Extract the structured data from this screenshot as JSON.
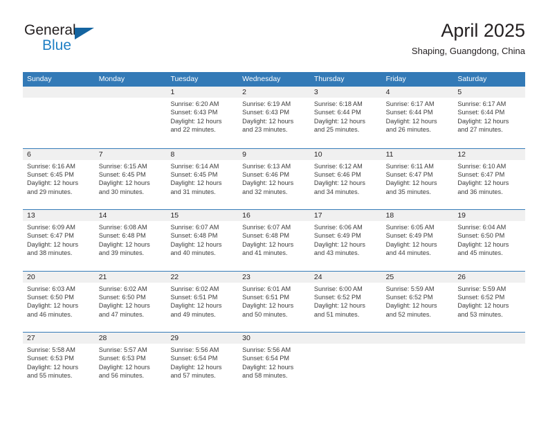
{
  "brand": {
    "name_part1": "General",
    "name_part2": "Blue",
    "triangle_color": "#1464a0",
    "blue_color": "#1f7fc4"
  },
  "header": {
    "month_title": "April 2025",
    "location": "Shaping, Guangdong, China"
  },
  "theme": {
    "header_blue": "#337ab7",
    "day_band_gray": "#f0f0f0",
    "text_dark": "#231f20"
  },
  "weekdays": [
    "Sunday",
    "Monday",
    "Tuesday",
    "Wednesday",
    "Thursday",
    "Friday",
    "Saturday"
  ],
  "weeks": [
    [
      {
        "day": "",
        "sunrise": "",
        "sunset": "",
        "daylight1": "",
        "daylight2": ""
      },
      {
        "day": "",
        "sunrise": "",
        "sunset": "",
        "daylight1": "",
        "daylight2": ""
      },
      {
        "day": "1",
        "sunrise": "Sunrise: 6:20 AM",
        "sunset": "Sunset: 6:43 PM",
        "daylight1": "Daylight: 12 hours",
        "daylight2": "and 22 minutes."
      },
      {
        "day": "2",
        "sunrise": "Sunrise: 6:19 AM",
        "sunset": "Sunset: 6:43 PM",
        "daylight1": "Daylight: 12 hours",
        "daylight2": "and 23 minutes."
      },
      {
        "day": "3",
        "sunrise": "Sunrise: 6:18 AM",
        "sunset": "Sunset: 6:44 PM",
        "daylight1": "Daylight: 12 hours",
        "daylight2": "and 25 minutes."
      },
      {
        "day": "4",
        "sunrise": "Sunrise: 6:17 AM",
        "sunset": "Sunset: 6:44 PM",
        "daylight1": "Daylight: 12 hours",
        "daylight2": "and 26 minutes."
      },
      {
        "day": "5",
        "sunrise": "Sunrise: 6:17 AM",
        "sunset": "Sunset: 6:44 PM",
        "daylight1": "Daylight: 12 hours",
        "daylight2": "and 27 minutes."
      }
    ],
    [
      {
        "day": "6",
        "sunrise": "Sunrise: 6:16 AM",
        "sunset": "Sunset: 6:45 PM",
        "daylight1": "Daylight: 12 hours",
        "daylight2": "and 29 minutes."
      },
      {
        "day": "7",
        "sunrise": "Sunrise: 6:15 AM",
        "sunset": "Sunset: 6:45 PM",
        "daylight1": "Daylight: 12 hours",
        "daylight2": "and 30 minutes."
      },
      {
        "day": "8",
        "sunrise": "Sunrise: 6:14 AM",
        "sunset": "Sunset: 6:45 PM",
        "daylight1": "Daylight: 12 hours",
        "daylight2": "and 31 minutes."
      },
      {
        "day": "9",
        "sunrise": "Sunrise: 6:13 AM",
        "sunset": "Sunset: 6:46 PM",
        "daylight1": "Daylight: 12 hours",
        "daylight2": "and 32 minutes."
      },
      {
        "day": "10",
        "sunrise": "Sunrise: 6:12 AM",
        "sunset": "Sunset: 6:46 PM",
        "daylight1": "Daylight: 12 hours",
        "daylight2": "and 34 minutes."
      },
      {
        "day": "11",
        "sunrise": "Sunrise: 6:11 AM",
        "sunset": "Sunset: 6:47 PM",
        "daylight1": "Daylight: 12 hours",
        "daylight2": "and 35 minutes."
      },
      {
        "day": "12",
        "sunrise": "Sunrise: 6:10 AM",
        "sunset": "Sunset: 6:47 PM",
        "daylight1": "Daylight: 12 hours",
        "daylight2": "and 36 minutes."
      }
    ],
    [
      {
        "day": "13",
        "sunrise": "Sunrise: 6:09 AM",
        "sunset": "Sunset: 6:47 PM",
        "daylight1": "Daylight: 12 hours",
        "daylight2": "and 38 minutes."
      },
      {
        "day": "14",
        "sunrise": "Sunrise: 6:08 AM",
        "sunset": "Sunset: 6:48 PM",
        "daylight1": "Daylight: 12 hours",
        "daylight2": "and 39 minutes."
      },
      {
        "day": "15",
        "sunrise": "Sunrise: 6:07 AM",
        "sunset": "Sunset: 6:48 PM",
        "daylight1": "Daylight: 12 hours",
        "daylight2": "and 40 minutes."
      },
      {
        "day": "16",
        "sunrise": "Sunrise: 6:07 AM",
        "sunset": "Sunset: 6:48 PM",
        "daylight1": "Daylight: 12 hours",
        "daylight2": "and 41 minutes."
      },
      {
        "day": "17",
        "sunrise": "Sunrise: 6:06 AM",
        "sunset": "Sunset: 6:49 PM",
        "daylight1": "Daylight: 12 hours",
        "daylight2": "and 43 minutes."
      },
      {
        "day": "18",
        "sunrise": "Sunrise: 6:05 AM",
        "sunset": "Sunset: 6:49 PM",
        "daylight1": "Daylight: 12 hours",
        "daylight2": "and 44 minutes."
      },
      {
        "day": "19",
        "sunrise": "Sunrise: 6:04 AM",
        "sunset": "Sunset: 6:50 PM",
        "daylight1": "Daylight: 12 hours",
        "daylight2": "and 45 minutes."
      }
    ],
    [
      {
        "day": "20",
        "sunrise": "Sunrise: 6:03 AM",
        "sunset": "Sunset: 6:50 PM",
        "daylight1": "Daylight: 12 hours",
        "daylight2": "and 46 minutes."
      },
      {
        "day": "21",
        "sunrise": "Sunrise: 6:02 AM",
        "sunset": "Sunset: 6:50 PM",
        "daylight1": "Daylight: 12 hours",
        "daylight2": "and 47 minutes."
      },
      {
        "day": "22",
        "sunrise": "Sunrise: 6:02 AM",
        "sunset": "Sunset: 6:51 PM",
        "daylight1": "Daylight: 12 hours",
        "daylight2": "and 49 minutes."
      },
      {
        "day": "23",
        "sunrise": "Sunrise: 6:01 AM",
        "sunset": "Sunset: 6:51 PM",
        "daylight1": "Daylight: 12 hours",
        "daylight2": "and 50 minutes."
      },
      {
        "day": "24",
        "sunrise": "Sunrise: 6:00 AM",
        "sunset": "Sunset: 6:52 PM",
        "daylight1": "Daylight: 12 hours",
        "daylight2": "and 51 minutes."
      },
      {
        "day": "25",
        "sunrise": "Sunrise: 5:59 AM",
        "sunset": "Sunset: 6:52 PM",
        "daylight1": "Daylight: 12 hours",
        "daylight2": "and 52 minutes."
      },
      {
        "day": "26",
        "sunrise": "Sunrise: 5:59 AM",
        "sunset": "Sunset: 6:52 PM",
        "daylight1": "Daylight: 12 hours",
        "daylight2": "and 53 minutes."
      }
    ],
    [
      {
        "day": "27",
        "sunrise": "Sunrise: 5:58 AM",
        "sunset": "Sunset: 6:53 PM",
        "daylight1": "Daylight: 12 hours",
        "daylight2": "and 55 minutes."
      },
      {
        "day": "28",
        "sunrise": "Sunrise: 5:57 AM",
        "sunset": "Sunset: 6:53 PM",
        "daylight1": "Daylight: 12 hours",
        "daylight2": "and 56 minutes."
      },
      {
        "day": "29",
        "sunrise": "Sunrise: 5:56 AM",
        "sunset": "Sunset: 6:54 PM",
        "daylight1": "Daylight: 12 hours",
        "daylight2": "and 57 minutes."
      },
      {
        "day": "30",
        "sunrise": "Sunrise: 5:56 AM",
        "sunset": "Sunset: 6:54 PM",
        "daylight1": "Daylight: 12 hours",
        "daylight2": "and 58 minutes."
      },
      {
        "day": "",
        "sunrise": "",
        "sunset": "",
        "daylight1": "",
        "daylight2": ""
      },
      {
        "day": "",
        "sunrise": "",
        "sunset": "",
        "daylight1": "",
        "daylight2": ""
      },
      {
        "day": "",
        "sunrise": "",
        "sunset": "",
        "daylight1": "",
        "daylight2": ""
      }
    ]
  ]
}
